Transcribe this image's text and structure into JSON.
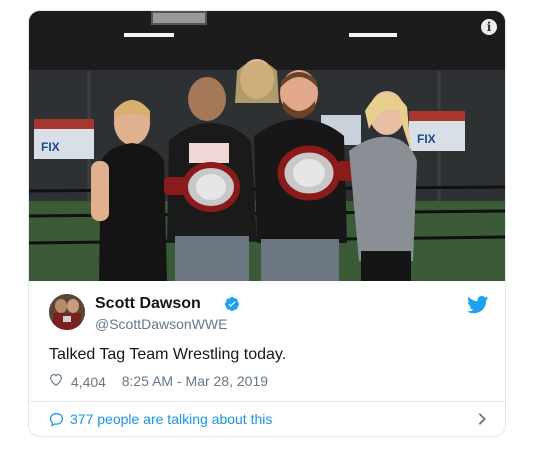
{
  "tweet": {
    "author_name": "Scott Dawson",
    "handle": "@ScottDawsonWWE",
    "verified": true,
    "text": "Talked Tag Team Wrestling today.",
    "likes": "4,404",
    "time": "8:25 AM - Mar 28, 2019",
    "footer_text": "377 people are talking about this"
  },
  "photo": {
    "description_icon": "info-icon",
    "banner_left": "FIX",
    "banner_right": "FIX"
  },
  "icons": {
    "verified": "verified-badge-icon",
    "brand": "twitter-bird-icon",
    "like": "heart-icon",
    "reply": "speech-bubble-icon",
    "more": "chevron-right-icon"
  },
  "colors": {
    "accent": "#1da1f2",
    "link": "#1b95e0",
    "muted": "#657786",
    "text": "#14171a",
    "border": "#e1e8ed"
  }
}
